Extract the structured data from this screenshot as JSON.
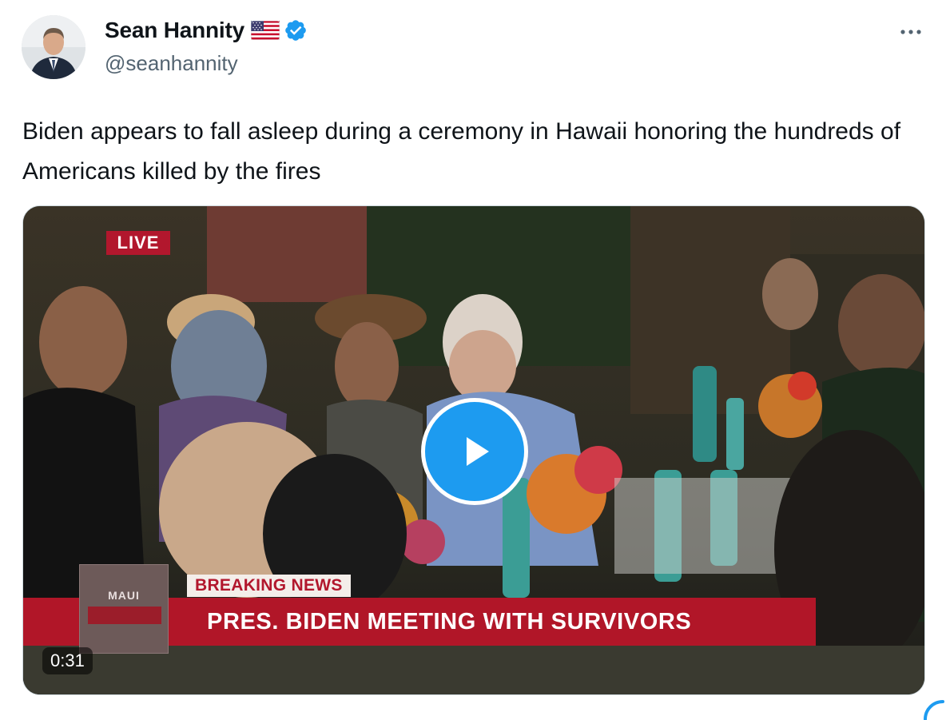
{
  "author": {
    "display_name": "Sean Hannity",
    "handle": "@seanhannity",
    "flag_icon": "us-flag-icon",
    "verified_icon": "verified-badge-icon",
    "verified_color": "#1d9bf0"
  },
  "tweet": {
    "text": "Biden appears to fall asleep during a ceremony in Hawaii honoring the hundreds of Americans killed by the fires"
  },
  "video": {
    "live_label": "LIVE",
    "station_label": "MAUI",
    "breaking_label": "BREAKING NEWS",
    "headline": "PRES. BIDEN MEETING WITH SURVIVORS",
    "duration": "0:31",
    "play_icon": "play-icon",
    "headline_color": "#b11628"
  },
  "more_icon": "more-options-icon"
}
